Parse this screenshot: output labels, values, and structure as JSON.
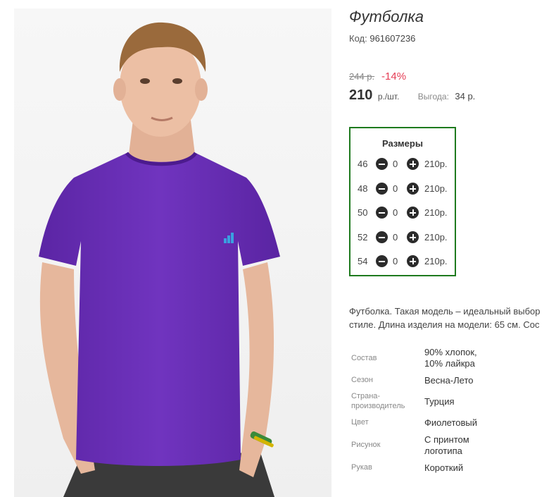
{
  "product": {
    "title": "Футболка",
    "code_label": "Код:",
    "code_value": "961607236",
    "old_price": "244 р.",
    "discount": "-14%",
    "price": "210",
    "price_unit": "р./шт.",
    "save_label": "Выгода:",
    "save_value": "34 р."
  },
  "sizes": {
    "title": "Размеры",
    "rows": [
      {
        "size": "46",
        "qty": "0",
        "price": "210р."
      },
      {
        "size": "48",
        "qty": "0",
        "price": "210р."
      },
      {
        "size": "50",
        "qty": "0",
        "price": "210р."
      },
      {
        "size": "52",
        "qty": "0",
        "price": "210р."
      },
      {
        "size": "54",
        "qty": "0",
        "price": "210р."
      }
    ]
  },
  "description": {
    "line1": "Футболка. Такая модель – идеальный выбор",
    "line2": "стиле. Длина изделия на модели: 65 см. Сос"
  },
  "attributes": [
    {
      "key": "Состав",
      "value_line1": "90% хлопок,",
      "value_line2": "10% лайкра"
    },
    {
      "key": "Сезон",
      "value_line1": "Весна-Лето"
    },
    {
      "key_line1": "Страна-",
      "key_line2": "производитель",
      "value_line1": "Турция"
    },
    {
      "key": "Цвет",
      "value_line1": "Фиолетовый"
    },
    {
      "key": "Рисунок",
      "value_line1": "С принтом",
      "value_line2": "логотипа"
    },
    {
      "key": "Рукав",
      "value_line1": "Короткий"
    }
  ],
  "colors": {
    "tshirt": "#6a2fb6",
    "logo": "#3aa0e0",
    "sizes_border": "#1e7a1e",
    "discount": "#e53c54"
  }
}
